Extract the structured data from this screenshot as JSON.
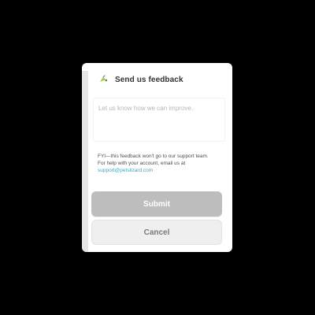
{
  "dialog": {
    "title": "Send us feedback",
    "placeholder": "Let us know how we can improve.",
    "notice_line1": "FYI—this feedback won't go to our support team.",
    "notice_line2": "For help with your account, email us at",
    "support_email": "support@petslizard.com",
    "submit_label": "Submit",
    "cancel_label": "Cancel"
  },
  "colors": {
    "accent": "#35a7d0",
    "icon_green": "#9ccc3a",
    "submit_bg": "#bdbdbd",
    "cancel_bg": "#efefef",
    "backdrop": "#000000"
  },
  "icons": {
    "header_icon": "feedback-icon"
  }
}
